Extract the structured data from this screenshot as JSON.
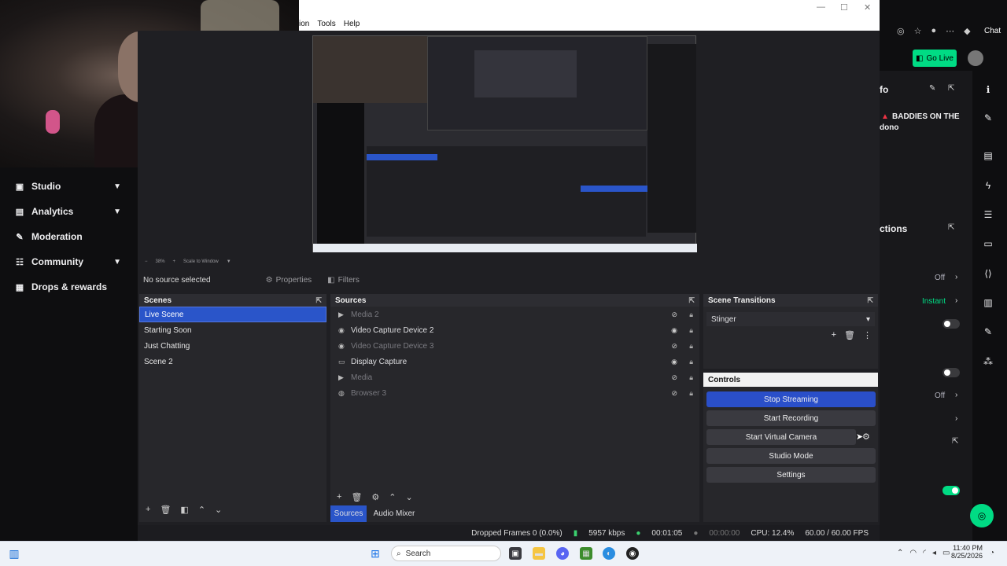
{
  "twitch": {
    "nav": [
      {
        "label": "Studio",
        "icon": "studio-icon",
        "expandable": true
      },
      {
        "label": "Analytics",
        "icon": "analytics-icon",
        "expandable": true
      },
      {
        "label": "Moderation",
        "icon": "wrench-icon",
        "expandable": false
      },
      {
        "label": "Community",
        "icon": "community-icon",
        "expandable": true
      },
      {
        "label": "Drops & rewards",
        "icon": "gift-icon",
        "expandable": false
      }
    ],
    "top": {
      "chat_label": "Chat",
      "go_live": "Go Live"
    },
    "panel": {
      "info_title": "fo",
      "stream_title": "BADDIES ON THE",
      "stream_title_2": "dono",
      "actions_title": "ctions",
      "row1_value": "Off",
      "row2_value": "Instant",
      "row5_value": "Off"
    },
    "colors": {
      "accent": "#00db84",
      "brand": "#9147ff"
    }
  },
  "obs": {
    "menu": [
      "ion",
      "Tools",
      "Help"
    ],
    "zoom": {
      "percent": "38%",
      "mode": "Scale to Window"
    },
    "source_bar": {
      "selected": "No source selected",
      "properties": "Properties",
      "filters": "Filters"
    },
    "scenes": {
      "title": "Scenes",
      "items": [
        "Live Scene",
        "Starting Soon",
        "Just Chatting",
        "Scene 2"
      ],
      "selected": 0
    },
    "sources": {
      "title": "Sources",
      "items": [
        {
          "name": "Media 2",
          "icon": "play-icon",
          "visible": false
        },
        {
          "name": "Video Capture Device 2",
          "icon": "camera-icon",
          "visible": true
        },
        {
          "name": "Video Capture Device 3",
          "icon": "camera-icon",
          "visible": false
        },
        {
          "name": "Display Capture",
          "icon": "monitor-icon",
          "visible": true
        },
        {
          "name": "Media",
          "icon": "play-icon",
          "visible": false
        },
        {
          "name": "Browser 3",
          "icon": "globe-icon",
          "visible": false
        }
      ],
      "tabs": [
        "Sources",
        "Audio Mixer"
      ]
    },
    "transitions": {
      "title": "Scene Transitions",
      "selected": "Stinger"
    },
    "controls": {
      "title": "Controls",
      "buttons": [
        "Stop Streaming",
        "Start Recording",
        "Start Virtual Camera",
        "Studio Mode",
        "Settings"
      ]
    },
    "status": {
      "dropped": "Dropped Frames 0 (0.0%)",
      "bitrate": "5957 kbps",
      "stream_time": "00:01:05",
      "rec_time": "00:00:00",
      "cpu": "CPU: 12.4%",
      "fps": "60.00 / 60.00 FPS"
    }
  },
  "taskbar": {
    "search": "Search",
    "time": "11:40 PM",
    "date": "8/25/2026"
  }
}
